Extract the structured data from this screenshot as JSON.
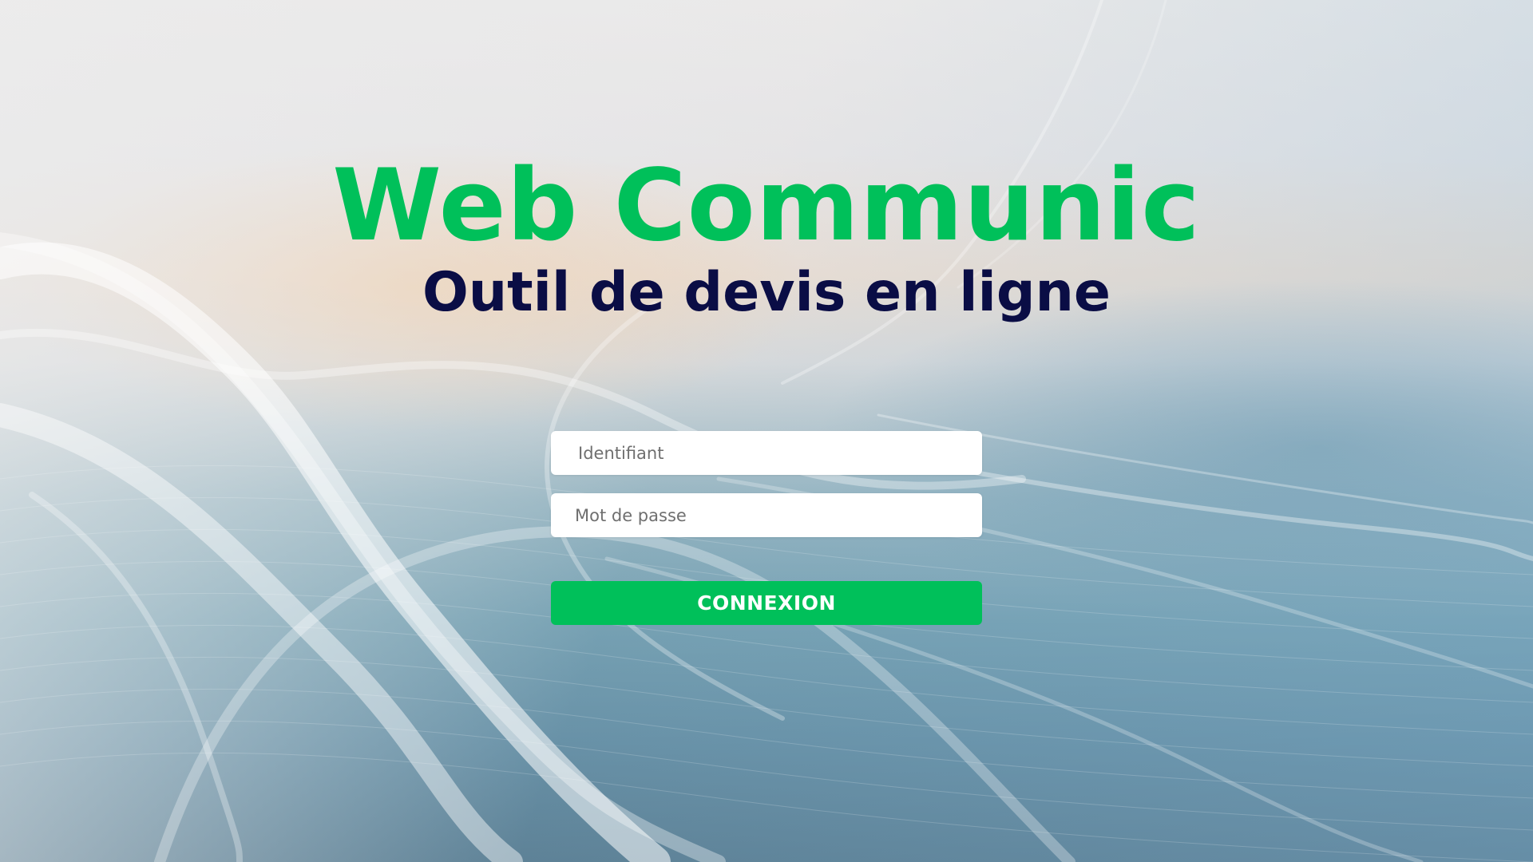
{
  "brand": {
    "title": "Web Communic",
    "subtitle": "Outil de devis en ligne"
  },
  "login": {
    "username_placeholder": "Identifiant",
    "username_value": "",
    "password_placeholder": "Mot de passe",
    "password_value": "",
    "submit_label": "CONNEXION"
  },
  "colors": {
    "accent": "#00c05a",
    "subtitle": "#0a0d45"
  }
}
